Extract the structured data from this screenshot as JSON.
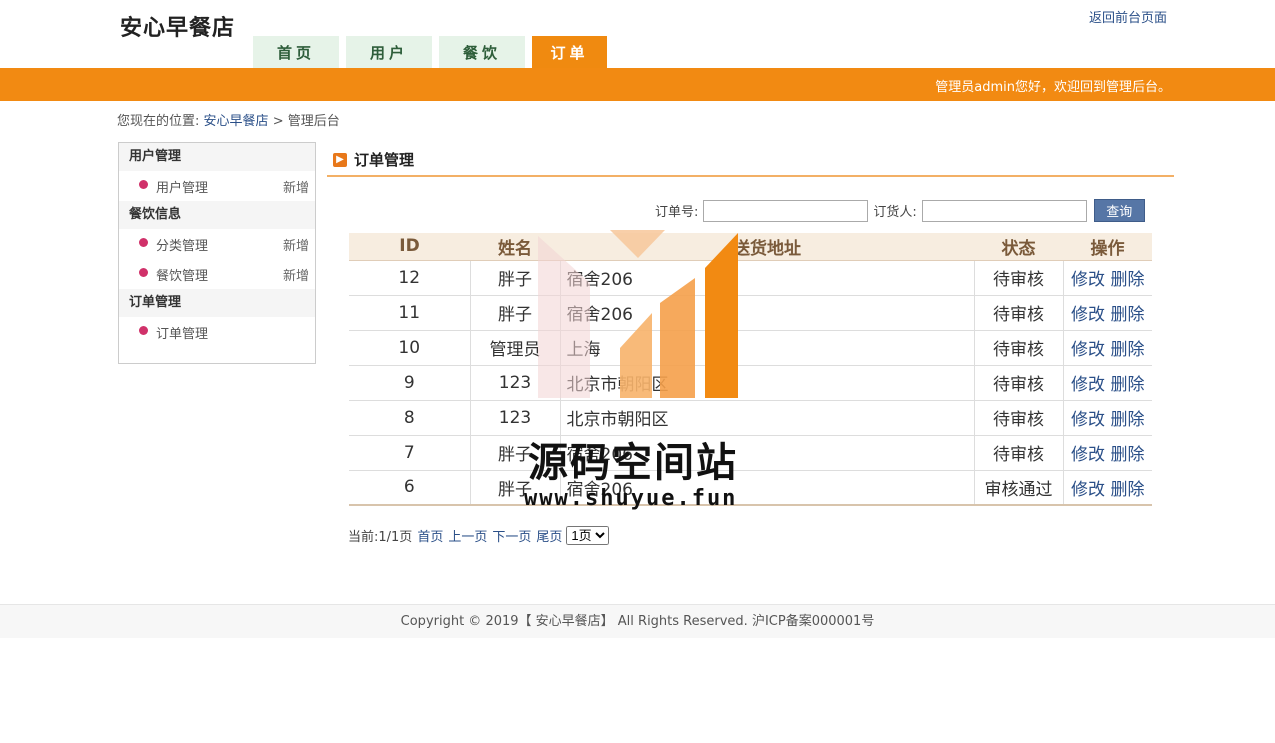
{
  "brand": "安心早餐店",
  "back_link": "返回前台页面",
  "nav": {
    "tabs": [
      {
        "label": "首页",
        "active": false
      },
      {
        "label": "用户",
        "active": false
      },
      {
        "label": "餐饮",
        "active": false
      },
      {
        "label": "订单",
        "active": true
      }
    ]
  },
  "topbar": {
    "welcome": "管理员admin您好，欢迎回到管理后台。"
  },
  "breadcrumb": {
    "prefix": "您现在的位置:",
    "home": "安心早餐店",
    "sep": ">",
    "current": "管理后台"
  },
  "sidebar": {
    "sections": [
      {
        "title": "用户管理",
        "items": [
          {
            "label": "用户管理",
            "add": "新增"
          }
        ]
      },
      {
        "title": "餐饮信息",
        "items": [
          {
            "label": "分类管理",
            "add": "新增"
          },
          {
            "label": "餐饮管理",
            "add": "新增"
          }
        ]
      },
      {
        "title": "订单管理",
        "items": [
          {
            "label": "订单管理",
            "add": ""
          }
        ]
      }
    ]
  },
  "content": {
    "title": "订单管理"
  },
  "search": {
    "order_no_label": "订单号:",
    "orderer_label": "订货人:",
    "order_no_value": "",
    "orderer_value": "",
    "button": "查询"
  },
  "table": {
    "headers": [
      "ID",
      "姓名",
      "送货地址",
      "状态",
      "操作"
    ],
    "edit_label": "修改",
    "delete_label": "删除",
    "rows": [
      {
        "id": "12",
        "name": "胖子",
        "address": "宿舍206",
        "status": "待审核"
      },
      {
        "id": "11",
        "name": "胖子",
        "address": "宿舍206",
        "status": "待审核"
      },
      {
        "id": "10",
        "name": "管理员",
        "address": "上海",
        "status": "待审核"
      },
      {
        "id": "9",
        "name": "123",
        "address": "北京市朝阳区",
        "status": "待审核"
      },
      {
        "id": "8",
        "name": "123",
        "address": "北京市朝阳区",
        "status": "待审核"
      },
      {
        "id": "7",
        "name": "胖子",
        "address": "宿舍206",
        "status": "待审核"
      },
      {
        "id": "6",
        "name": "胖子",
        "address": "宿舍206",
        "status": "审核通过"
      }
    ]
  },
  "pager": {
    "current": "当前:1/1页",
    "first": "首页",
    "prev": "上一页",
    "next": "下一页",
    "last": "尾页",
    "page_select": "1页"
  },
  "footer": {
    "text": "Copyright © 2019【 安心早餐店】 All Rights Reserved. 沪ICP备案000001号"
  },
  "watermark": {
    "text": "源码空间站",
    "url": "www.shuyue.fun"
  },
  "colors": {
    "accent": "#f28a12",
    "link": "#2a4f88",
    "button": "#5676a6"
  }
}
